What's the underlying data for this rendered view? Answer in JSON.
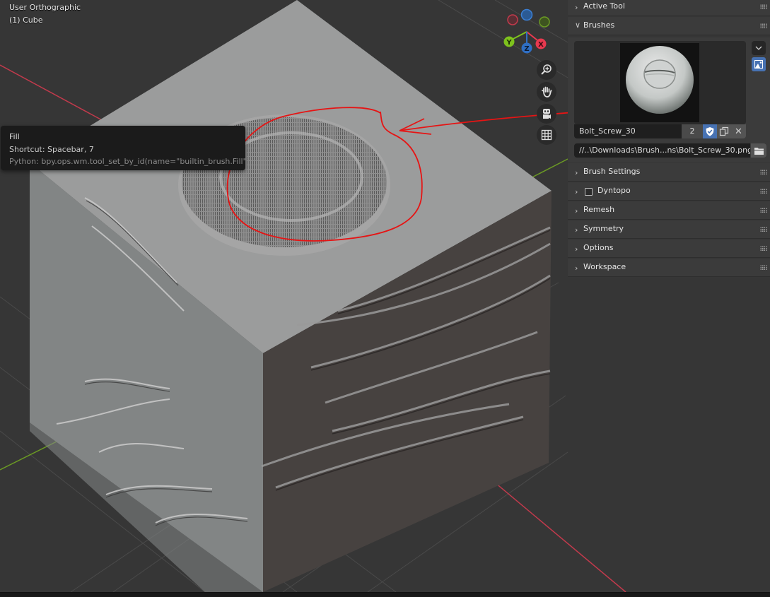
{
  "viewport": {
    "view_name": "User Orthographic",
    "object_name": "(1) Cube"
  },
  "tooltip": {
    "title": "Fill",
    "shortcut": "Shortcut: Spacebar, 7",
    "python": "Python: bpy.ops.wm.tool_set_by_id(name=\"builtin_brush.Fill\")"
  },
  "gizmo": {
    "axes": [
      {
        "label": "X",
        "color": "#e8394f"
      },
      {
        "label": "Y",
        "color": "#7ec21d"
      },
      {
        "label": "Z",
        "color": "#2f6fc4"
      }
    ]
  },
  "nav_buttons": [
    {
      "icon": "zoom-icon"
    },
    {
      "icon": "pan-hand-icon"
    },
    {
      "icon": "camera-icon"
    },
    {
      "icon": "grid-icon"
    }
  ],
  "sidebar": {
    "panels": [
      {
        "label": "Active Tool",
        "expanded": false
      },
      {
        "label": "Brushes",
        "expanded": true
      },
      {
        "label": "Brush Settings",
        "expanded": false
      },
      {
        "label": "Dyntopo",
        "expanded": false,
        "checkbox": false
      },
      {
        "label": "Remesh",
        "expanded": false
      },
      {
        "label": "Symmetry",
        "expanded": false
      },
      {
        "label": "Options",
        "expanded": false
      },
      {
        "label": "Workspace",
        "expanded": false
      }
    ],
    "brushes": {
      "brush_name": "Bolt_Screw_30",
      "users": "2",
      "texture_path": "//..\\Downloads\\Brush...ns\\Bolt_Screw_30.png"
    }
  },
  "colors": {
    "accent": "#4772b3",
    "annotation": "#e61414",
    "axis_x": "#c23a4c",
    "axis_y": "#6b9a24"
  }
}
